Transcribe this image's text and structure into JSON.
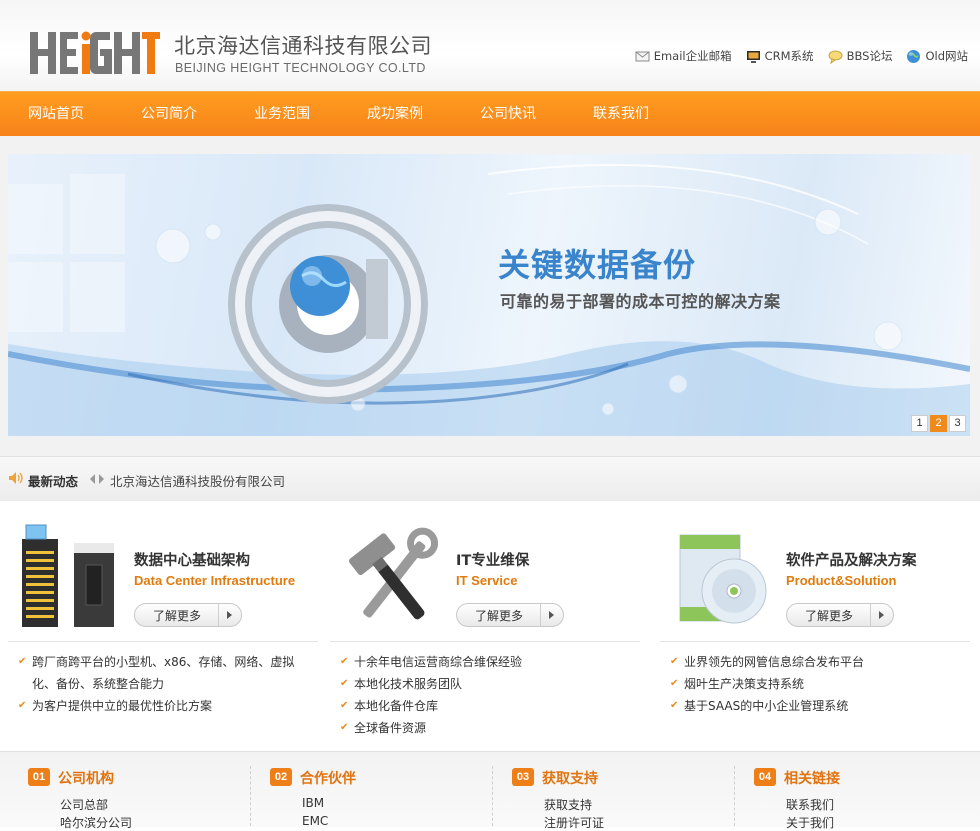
{
  "header": {
    "logo_text": "HEIGHT",
    "company_cn": "北京海达信通科技有限公司",
    "company_en": "BEIJING HEIGHT TECHNOLOGY CO.LTD",
    "toplinks": [
      "Email企业邮箱",
      "CRM系统",
      "BBS论坛",
      "Old网站"
    ]
  },
  "nav": [
    "网站首页",
    "公司简介",
    "业务范围",
    "成功案例",
    "公司快讯",
    "联系我们"
  ],
  "banner": {
    "title": "关键数据备份",
    "subtitle": "可靠的易于部署的成本可控的解决方案",
    "pages": [
      "1",
      "2",
      "3"
    ],
    "active_page": "2"
  },
  "news": {
    "label": "最新动态",
    "text": "北京海达信通科技股份有限公司"
  },
  "services": [
    {
      "title": "数据中心基础架构",
      "en": "Data Center Infrastructure",
      "more": "了解更多",
      "items": [
        "跨厂商跨平台的小型机、x86、存储、网络、虚拟化、备份、系统整合能力",
        "为客户提供中立的最优性价比方案"
      ]
    },
    {
      "title": "IT专业维保",
      "en": "IT Service",
      "more": "了解更多",
      "items": [
        "十余年电信运营商综合维保经验",
        "本地化技术服务团队",
        "本地化备件仓库",
        "全球备件资源"
      ]
    },
    {
      "title": "软件产品及解决方案",
      "en": "Product&Solution",
      "more": "了解更多",
      "items": [
        "业界领先的网管信息综合发布平台",
        "烟叶生产决策支持系统",
        "基于SAAS的中小企业管理系统"
      ]
    }
  ],
  "footer": [
    {
      "num": "01",
      "title": "公司机构",
      "links": [
        "公司总部",
        "哈尔滨分公司"
      ]
    },
    {
      "num": "02",
      "title": "合作伙伴",
      "links": [
        "IBM",
        "EMC"
      ]
    },
    {
      "num": "03",
      "title": "获取支持",
      "links": [
        "获取支持",
        "注册许可证"
      ]
    },
    {
      "num": "04",
      "title": "相关链接",
      "links": [
        "联系我们",
        "关于我们"
      ]
    }
  ],
  "colors": {
    "accent": "#f7871c",
    "banner_title": "#3a84cc",
    "service_en": "#e07b0f"
  }
}
